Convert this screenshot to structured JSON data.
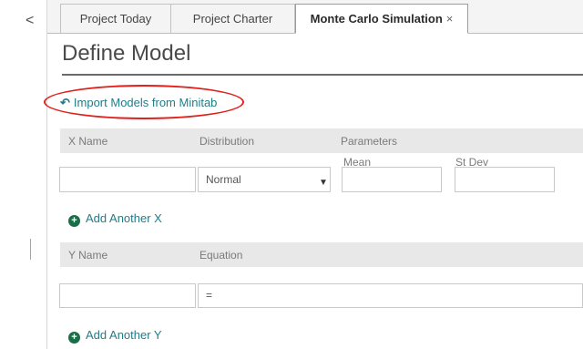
{
  "nav": {
    "back_glyph": "<"
  },
  "tabs": [
    {
      "label": "Project Today"
    },
    {
      "label": "Project Charter"
    },
    {
      "label": "Monte Carlo Simulation",
      "close_glyph": "×",
      "active": true
    }
  ],
  "page": {
    "title": "Define Model",
    "import_link": "Import Models from Minitab"
  },
  "x_section": {
    "headers": {
      "name": "X Name",
      "distribution": "Distribution",
      "parameters": "Parameters"
    },
    "param_labels": {
      "mean": "Mean",
      "stdev": "St Dev"
    },
    "row": {
      "name": "",
      "distribution": "Normal",
      "mean": "",
      "stdev": ""
    },
    "add_label": "Add Another X"
  },
  "y_section": {
    "headers": {
      "name": "Y Name",
      "equation": "Equation"
    },
    "row": {
      "name": "",
      "equation": "="
    },
    "add_label": "Add Another Y"
  },
  "colors": {
    "accent": "#1f7d8a",
    "add_icon": "#1a6e47",
    "annotation": "#e0201c"
  },
  "icons": {
    "back": "chevron-left-icon",
    "import": "undo-arrow-icon",
    "add": "plus-circle-icon",
    "dropdown": "caret-down-icon"
  }
}
